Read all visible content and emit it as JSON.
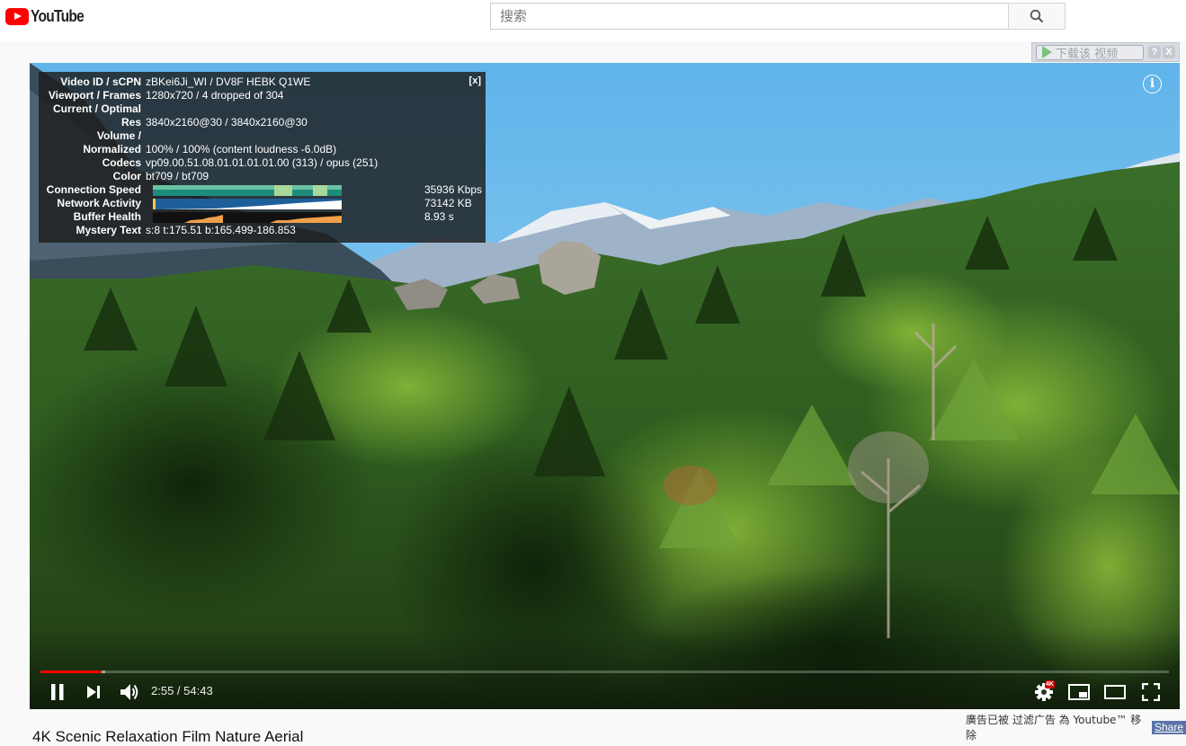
{
  "header": {
    "logo_text": "YouTube",
    "search_placeholder": "搜索"
  },
  "downloader": {
    "label": "下载该 视频",
    "help": "?",
    "close": "X"
  },
  "stats": {
    "close": "[x]",
    "rows": [
      {
        "label": "Video ID / sCPN",
        "value": "zBKei6Ji_WI / DV8F HEBK Q1WE"
      },
      {
        "label": "Viewport / Frames",
        "value": "1280x720 / 4 dropped of 304"
      },
      {
        "label": "Current / Optimal",
        "value": ""
      },
      {
        "label": "Res",
        "value": "3840x2160@30 / 3840x2160@30"
      },
      {
        "label": "Volume /",
        "value": ""
      },
      {
        "label": "Normalized",
        "value": "100% / 100% (content loudness -6.0dB)"
      },
      {
        "label": "Codecs",
        "value": "vp09.00.51.08.01.01.01.01.00 (313) / opus (251)"
      },
      {
        "label": "Color",
        "value": "bt709 / bt709"
      },
      {
        "label": "Connection Speed",
        "value": "35936 Kbps"
      },
      {
        "label": "Network Activity",
        "value": "73142 KB"
      },
      {
        "label": "Buffer Health",
        "value": "8.93 s"
      },
      {
        "label": "Mystery Text",
        "value": "s:8 t:175.51 b:165.499-186.853"
      }
    ]
  },
  "player": {
    "info": "i",
    "time": "2:55 / 54:43",
    "played_fraction": 0.054,
    "loaded_fraction": 0.057,
    "quality_badge": "4K"
  },
  "adbar": {
    "text": "廣告已被 过滤广告 為 Youtube™ 移除",
    "share": "Share"
  },
  "video_title": "4K Scenic Relaxation Film Nature Aerial"
}
